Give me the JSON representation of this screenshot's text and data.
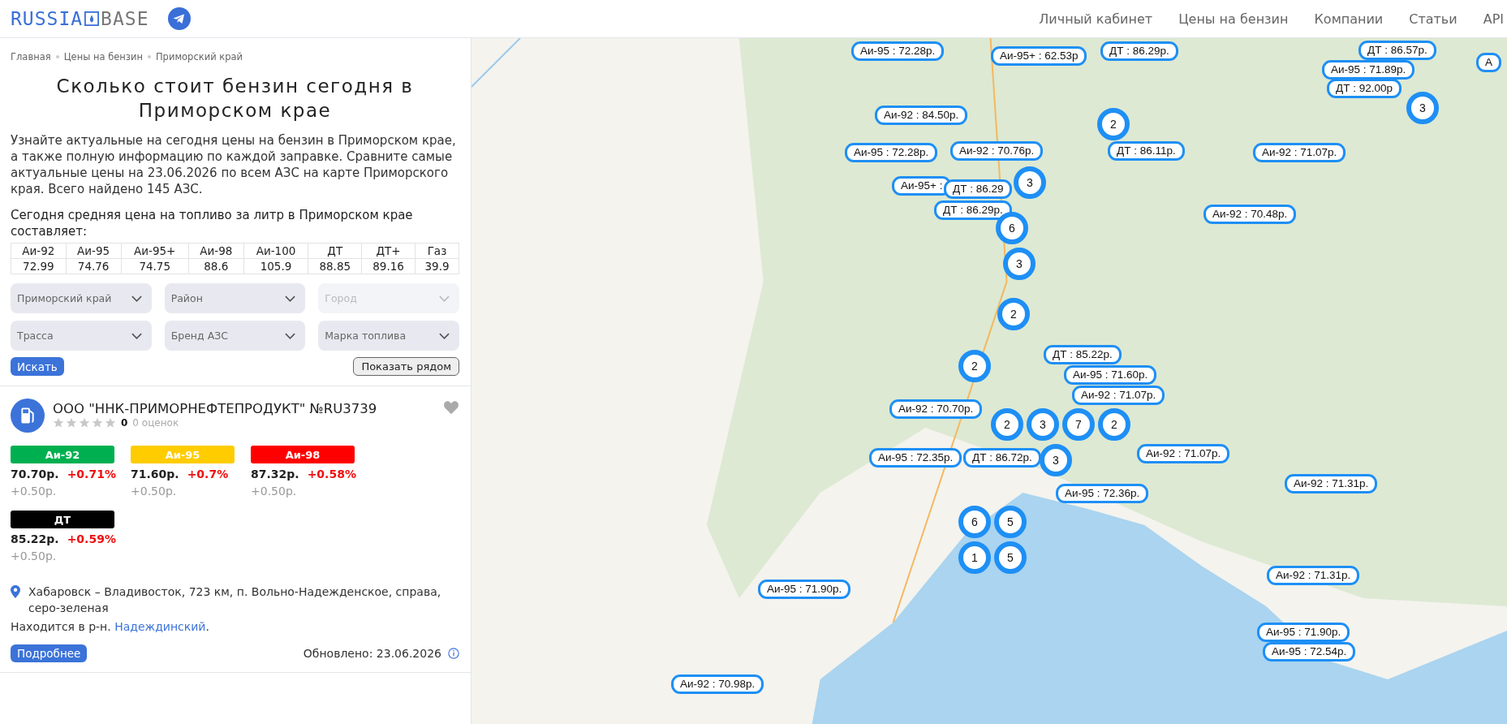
{
  "header": {
    "logo": {
      "first": "RUSSIA",
      "second": "BASE"
    },
    "nav": [
      "Личный кабинет",
      "Цены на бензин",
      "Компании",
      "Статьи",
      "API"
    ]
  },
  "breadcrumbs": [
    "Главная",
    "Цены на бензин",
    "Приморский край"
  ],
  "title": "Сколько стоит бензин сегодня в Приморском крае",
  "intro": "Узнайте актуальные на сегодня цены на бензин в Приморском крае, а также полную информацию по каждой заправке. Сравните самые актуальные цены на 23.06.2026 по всем АЗС на карте Приморского края. Всего найдено 145 АЗС.",
  "avg_heading": "Сегодня средняя цена на топливо за литр в Приморском крае составляет:",
  "avg_prices": [
    {
      "fuel": "Аи-92",
      "price": "72.99"
    },
    {
      "fuel": "Аи-95",
      "price": "74.76"
    },
    {
      "fuel": "Аи-95+",
      "price": "74.75"
    },
    {
      "fuel": "Аи-98",
      "price": "88.6"
    },
    {
      "fuel": "Аи-100",
      "price": "105.9"
    },
    {
      "fuel": "ДТ",
      "price": "88.85"
    },
    {
      "fuel": "ДТ+",
      "price": "89.16"
    },
    {
      "fuel": "Газ",
      "price": "39.9"
    }
  ],
  "filters": [
    {
      "label": "Приморский край",
      "disabled": false
    },
    {
      "label": "Район",
      "disabled": false
    },
    {
      "label": "Город",
      "disabled": true
    },
    {
      "label": "Трасса",
      "disabled": false
    },
    {
      "label": "Бренд АЗС",
      "disabled": false
    },
    {
      "label": "Марка топлива",
      "disabled": false
    }
  ],
  "search_button": "Искать",
  "nearby_button": "Показать рядом",
  "station": {
    "name": "ООО \"ННК-ПРИМОРНЕФТЕПРОДУКТ\" №RU3739",
    "stars": 0,
    "rating": "0",
    "reviews": "0 оценок",
    "fuels": [
      {
        "label": "Аи-92",
        "color": "#00b050",
        "price": "70.70р.",
        "change": "+0.71%",
        "delta": "+0.50р."
      },
      {
        "label": "Аи-95",
        "color": "#ffcc00",
        "price": "71.60р.",
        "change": "+0.7%",
        "delta": "+0.50р."
      },
      {
        "label": "Аи-98",
        "color": "#ff0000",
        "price": "87.32р.",
        "change": "+0.58%",
        "delta": "+0.50р."
      },
      {
        "label": "ДТ",
        "color": "#000000",
        "price": "85.22р.",
        "change": "+0.59%",
        "delta": "+0.50р."
      }
    ],
    "address": "Хабаровск – Владивосток, 723 км, п. Вольно-Надежденское, справа, серо-зеленая",
    "district_prefix": "Находится в р-н.",
    "district": "Надеждинский",
    "district_suffix": ".",
    "more_button": "Подробнее",
    "updated": "Обновлено: 23.06.2026"
  },
  "map": {
    "markers": [
      {
        "kind": "price",
        "text": "Аи-95 : 72.28р."
      },
      {
        "kind": "price",
        "text": "Аи-95+ : 62.53р"
      },
      {
        "kind": "price",
        "text": "ДТ : 86.29р."
      },
      {
        "kind": "price",
        "text": "ДТ : 86.57р."
      },
      {
        "kind": "price",
        "text": "Аи-95 : 71.89р."
      },
      {
        "kind": "price",
        "text": "ДТ : 92.00р"
      },
      {
        "kind": "cluster",
        "text": "3"
      },
      {
        "kind": "price",
        "text": "А"
      },
      {
        "kind": "price",
        "text": "Аи-92 : 84.50р."
      },
      {
        "kind": "cluster",
        "text": "2"
      },
      {
        "kind": "price",
        "text": "Аи-95 : 72.28р."
      },
      {
        "kind": "price",
        "text": "Аи-92 : 70.76р."
      },
      {
        "kind": "price",
        "text": "ДТ : 86.11р."
      },
      {
        "kind": "price",
        "text": "Аи-92 : 71.07р."
      },
      {
        "kind": "price",
        "text": "Аи-95+ :"
      },
      {
        "kind": "price",
        "text": "ДТ : 86.29"
      },
      {
        "kind": "cluster",
        "text": "3"
      },
      {
        "kind": "price",
        "text": "ДТ : 86.29р."
      },
      {
        "kind": "price",
        "text": "Аи-92 : 70.48р."
      },
      {
        "kind": "cluster",
        "text": "6"
      },
      {
        "kind": "cluster",
        "text": "3"
      },
      {
        "kind": "cluster",
        "text": "2"
      },
      {
        "kind": "cluster",
        "text": "2"
      },
      {
        "kind": "price",
        "text": "ДТ : 85.22р."
      },
      {
        "kind": "price",
        "text": "Аи-95 : 71.60р."
      },
      {
        "kind": "price",
        "text": "Аи-92 : 71.07р."
      },
      {
        "kind": "cluster",
        "text": "2"
      },
      {
        "kind": "cluster",
        "text": "3"
      },
      {
        "kind": "cluster",
        "text": "7"
      },
      {
        "kind": "cluster",
        "text": "2"
      },
      {
        "kind": "price",
        "text": "Аи-92 : 70.70р."
      },
      {
        "kind": "price",
        "text": "Аи-95 : 72.35р."
      },
      {
        "kind": "price",
        "text": "ДТ : 86.72р."
      },
      {
        "kind": "cluster",
        "text": "3"
      },
      {
        "kind": "price",
        "text": "Аи-92 : 71.07р."
      },
      {
        "kind": "price",
        "text": "Аи-95 : 72.36р."
      },
      {
        "kind": "cluster",
        "text": "6"
      },
      {
        "kind": "cluster",
        "text": "5"
      },
      {
        "kind": "cluster",
        "text": "1"
      },
      {
        "kind": "cluster",
        "text": "5"
      },
      {
        "kind": "price",
        "text": "Аи-92 : 71.31р."
      },
      {
        "kind": "price",
        "text": "Аи-95 : 71.90р."
      },
      {
        "kind": "price",
        "text": "Аи-92 : 71.31р."
      },
      {
        "kind": "price",
        "text": "Аи-95 : 71.90р."
      },
      {
        "kind": "price",
        "text": "Аи-95 : 72.54р."
      },
      {
        "kind": "price",
        "text": "Аи-92 : 70.98р."
      }
    ]
  }
}
